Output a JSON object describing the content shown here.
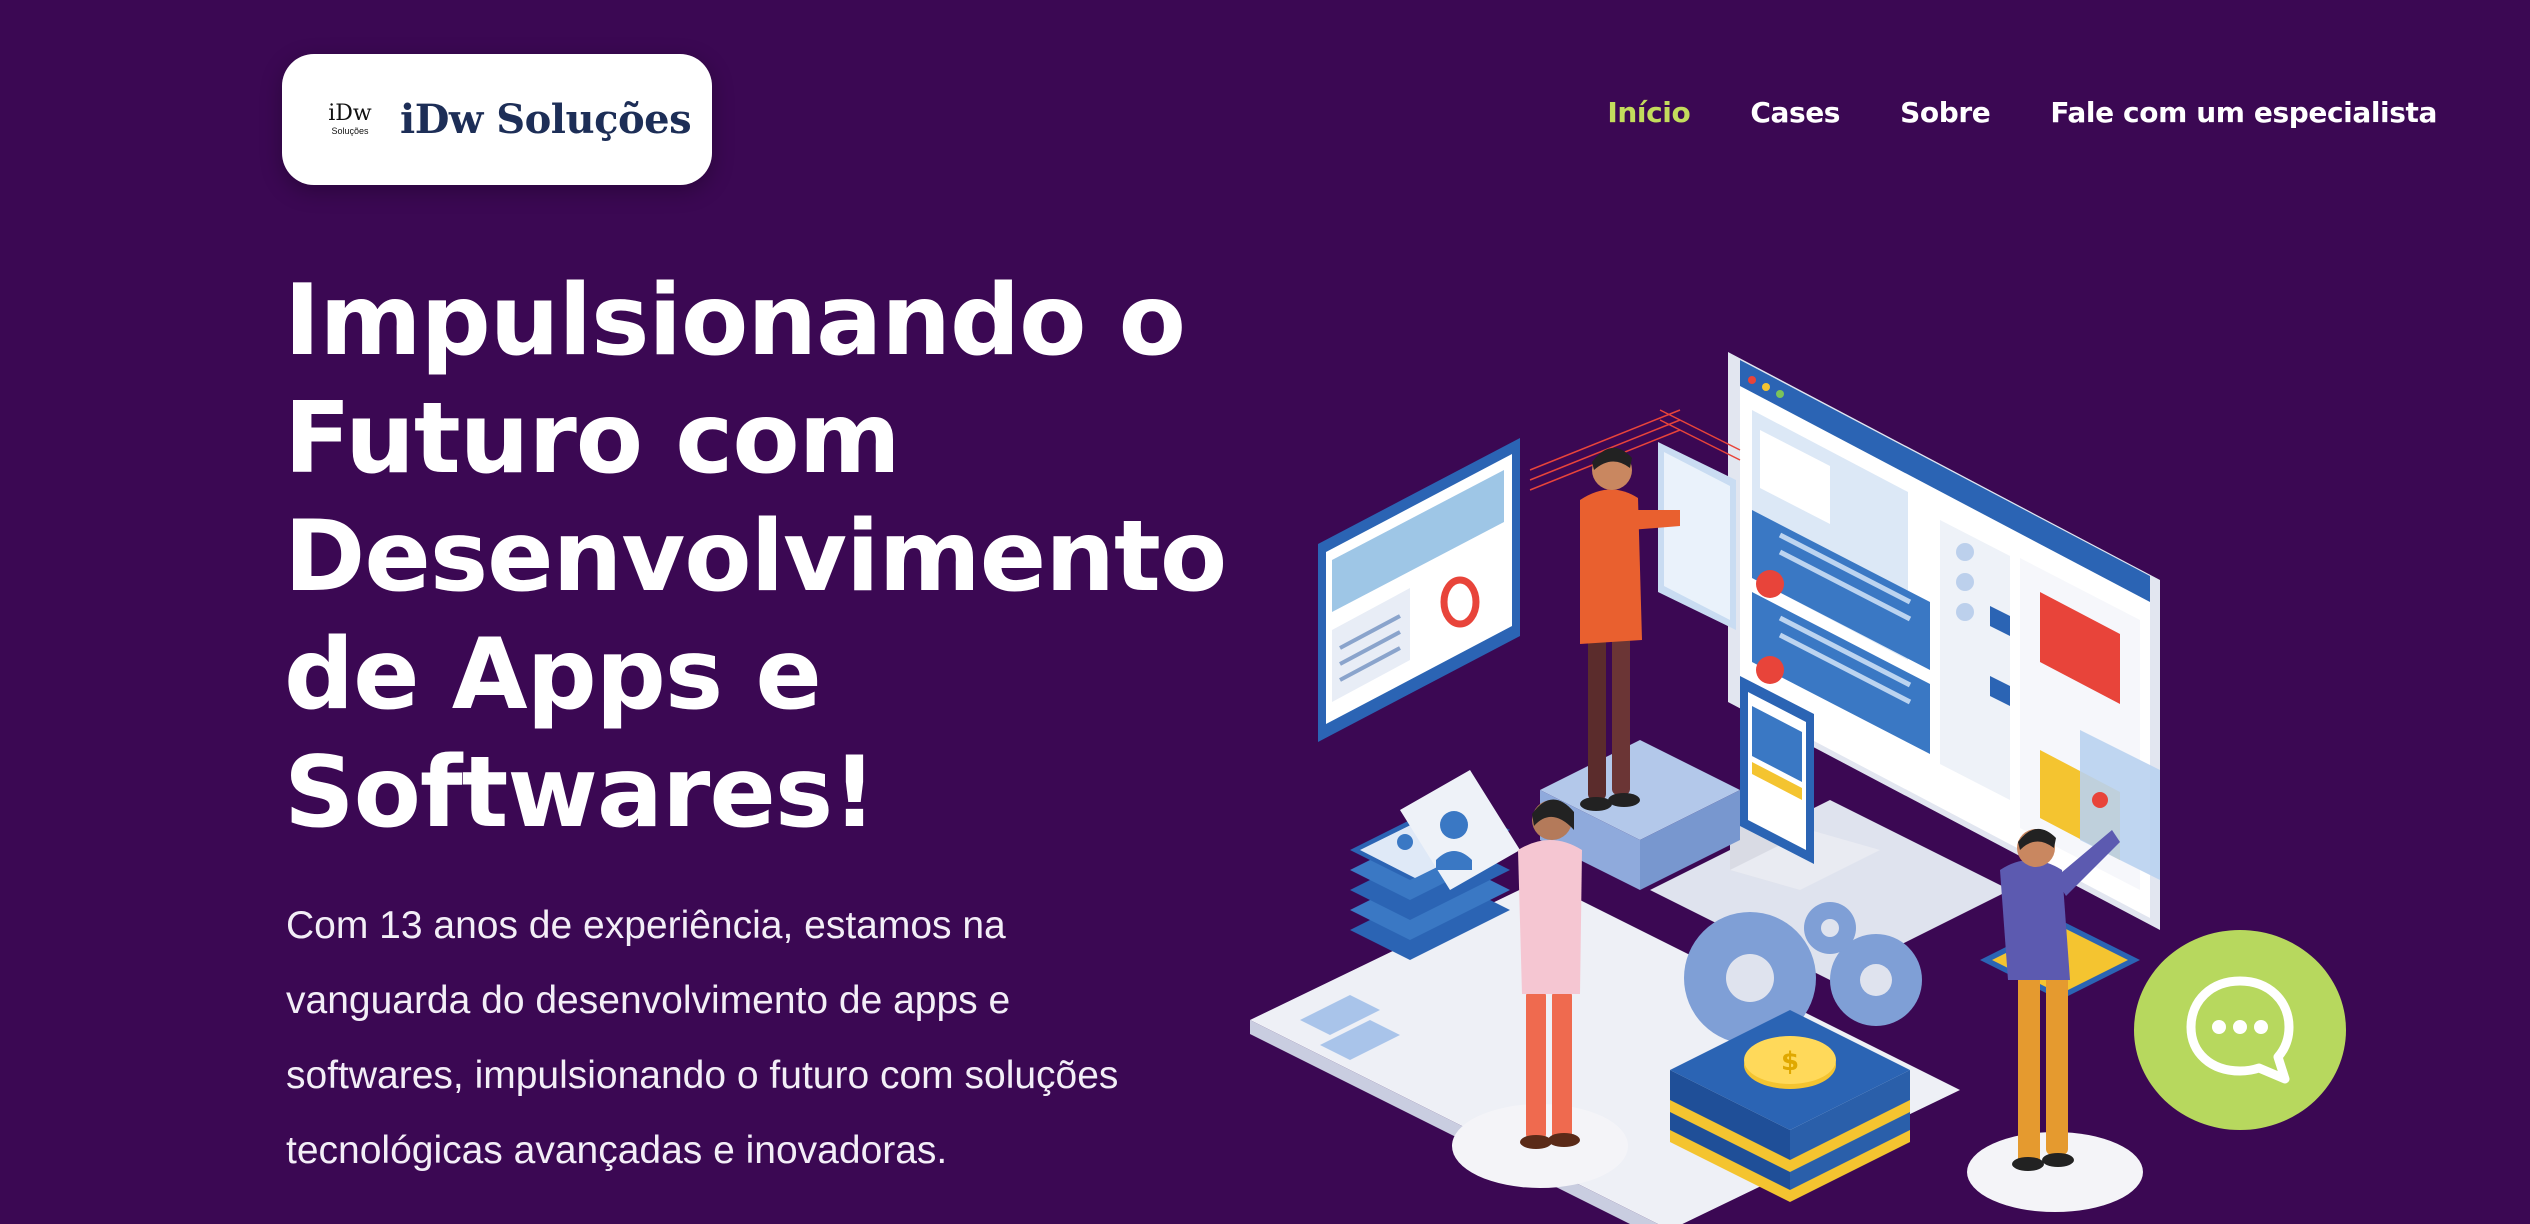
{
  "brand": {
    "mark_top": "iDw",
    "mark_bottom": "Soluções",
    "name": "iDw Soluções"
  },
  "nav": {
    "items": [
      {
        "label": "Início",
        "active": true
      },
      {
        "label": "Cases",
        "active": false
      },
      {
        "label": "Sobre",
        "active": false
      },
      {
        "label": "Fale com um especialista",
        "active": false
      }
    ]
  },
  "hero": {
    "title_lines": [
      "Impulsionando o",
      "Futuro com",
      "Desenvolvimento",
      "de Apps e",
      "Softwares!"
    ],
    "description_lines": [
      "Com 13 anos de experiência, estamos na",
      "vanguarda do desenvolvimento de apps e",
      "softwares, impulsionando o futuro com soluções",
      "tecnológicas avançadas e inovadoras."
    ]
  },
  "illustration": {
    "icon": "isometric-software-team-illustration",
    "coin_symbol": "$"
  },
  "chat": {
    "icon": "chat-bubble-icon"
  },
  "colors": {
    "background": "#3b0853",
    "nav_active": "#c3dc5c",
    "chat_button": "#b7d85e",
    "logo_text": "#1d2e57"
  }
}
